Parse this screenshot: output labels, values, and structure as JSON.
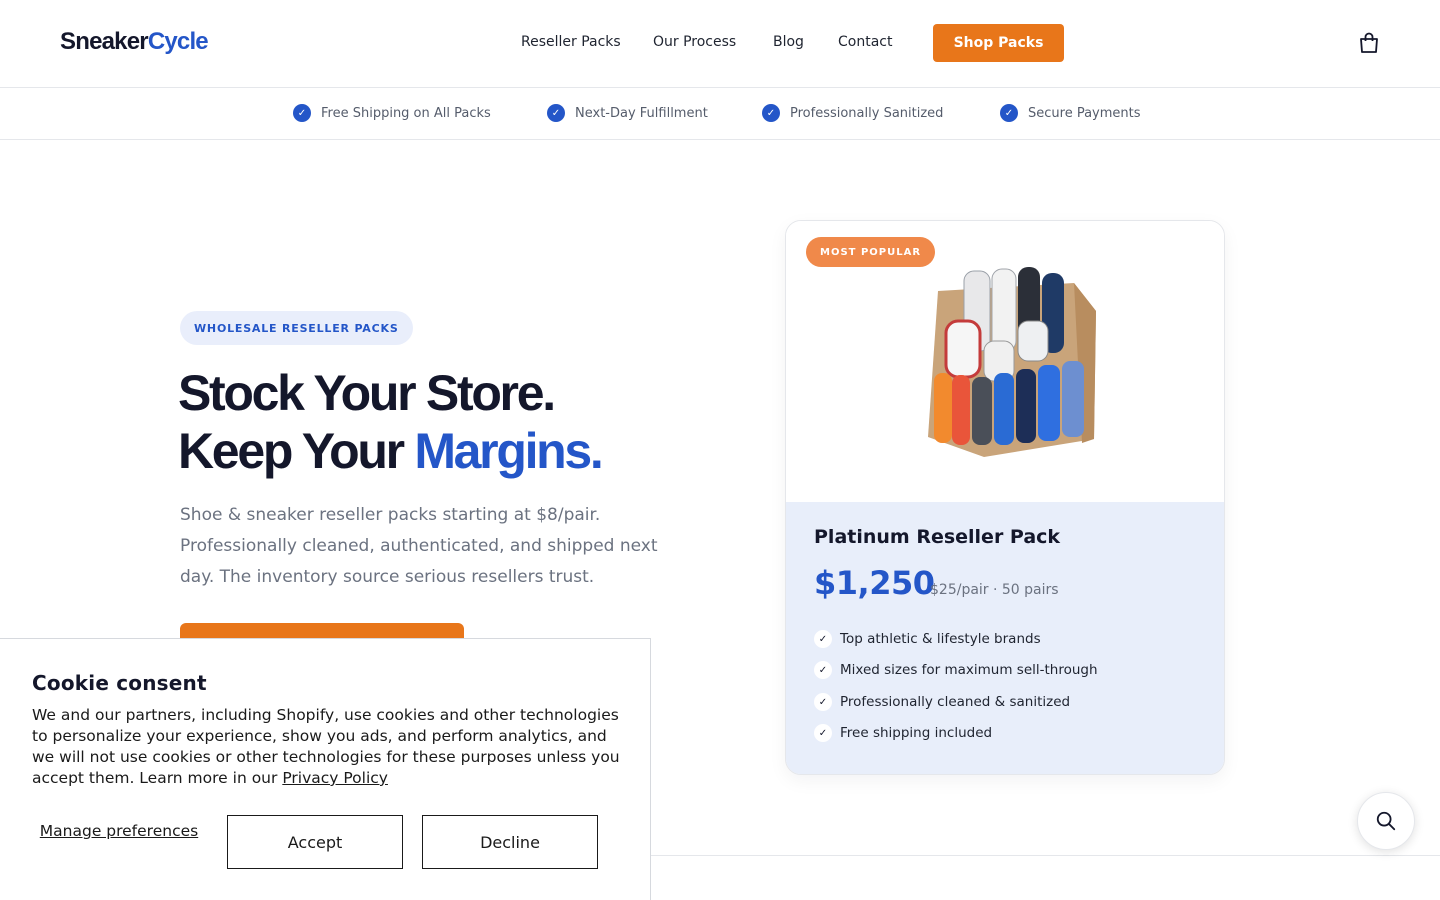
{
  "header": {
    "logo_part1": "Sneaker",
    "logo_part2": "Cycle",
    "nav": [
      "Reseller Packs",
      "Our Process",
      "Blog",
      "Contact"
    ],
    "cta": "Shop Packs",
    "cart_icon": "shopping-bag-icon"
  },
  "trust_bar": [
    "Free Shipping on All Packs",
    "Next-Day Fulfillment",
    "Professionally Sanitized",
    "Secure Payments"
  ],
  "hero": {
    "badge": "WHOLESALE RESELLER PACKS",
    "headline_line1": "Stock Your Store.",
    "headline_line2_prefix": "Keep Your ",
    "headline_highlight": "Margins.",
    "subtext": "Shoe & sneaker reseller packs starting at $8/pair. Professionally cleaned, authenticated, and shipped next day. The inventory source serious resellers trust."
  },
  "product_card": {
    "badge": "MOST POPULAR",
    "title": "Platinum Reseller Pack",
    "price": "$1,250",
    "price_meta": "$25/pair · 50 pairs",
    "features": [
      "Top athletic & lifestyle brands",
      "Mixed sizes for maximum sell-through",
      "Professionally cleaned & sanitized",
      "Free shipping included"
    ]
  },
  "cookie": {
    "title": "Cookie consent",
    "text": "We and our partners, including Shopify, use cookies and other technologies to personalize your experience, show you ads, and perform analytics, and we will not use cookies or other technologies for these purposes unless you accept them. Learn more in our ",
    "link": "Privacy Policy",
    "manage": "Manage preferences",
    "accept": "Accept",
    "decline": "Decline"
  },
  "colors": {
    "brand_blue": "#2456c8",
    "brand_orange": "#e8761a",
    "dark": "#14172b"
  }
}
